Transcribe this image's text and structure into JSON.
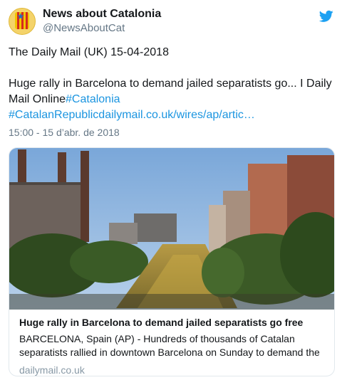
{
  "author": {
    "display_name": "News about Catalonia",
    "handle": "@NewsAboutCat"
  },
  "tweet": {
    "line1": "The Daily Mail (UK) 15-04-2018",
    "line2": "Huge rally in Barcelona to demand jailed separatists go... I Daily",
    "line3_text": "Mail Online",
    "line3_hashtag": "#Catalonia",
    "line4_link": "#CatalanRepublicdailymail.co.uk/wires/ap/artic…",
    "timestamp": "15:00 - 15 d’abr. de 2018"
  },
  "card": {
    "title": "Huge rally in Barcelona to demand jailed separatists go free",
    "description_line1": "BARCELONA, Spain (AP) - Hundreds of thousands of Catalan",
    "description_line2": "separatists rallied in downtown Barcelona on Sunday to demand the",
    "domain": "dailymail.co.uk"
  },
  "colors": {
    "link": "#1b95e0",
    "twitter_blue": "#1da1f2",
    "muted": "#657786"
  },
  "icons": {
    "logo": "twitter-bird-icon"
  }
}
